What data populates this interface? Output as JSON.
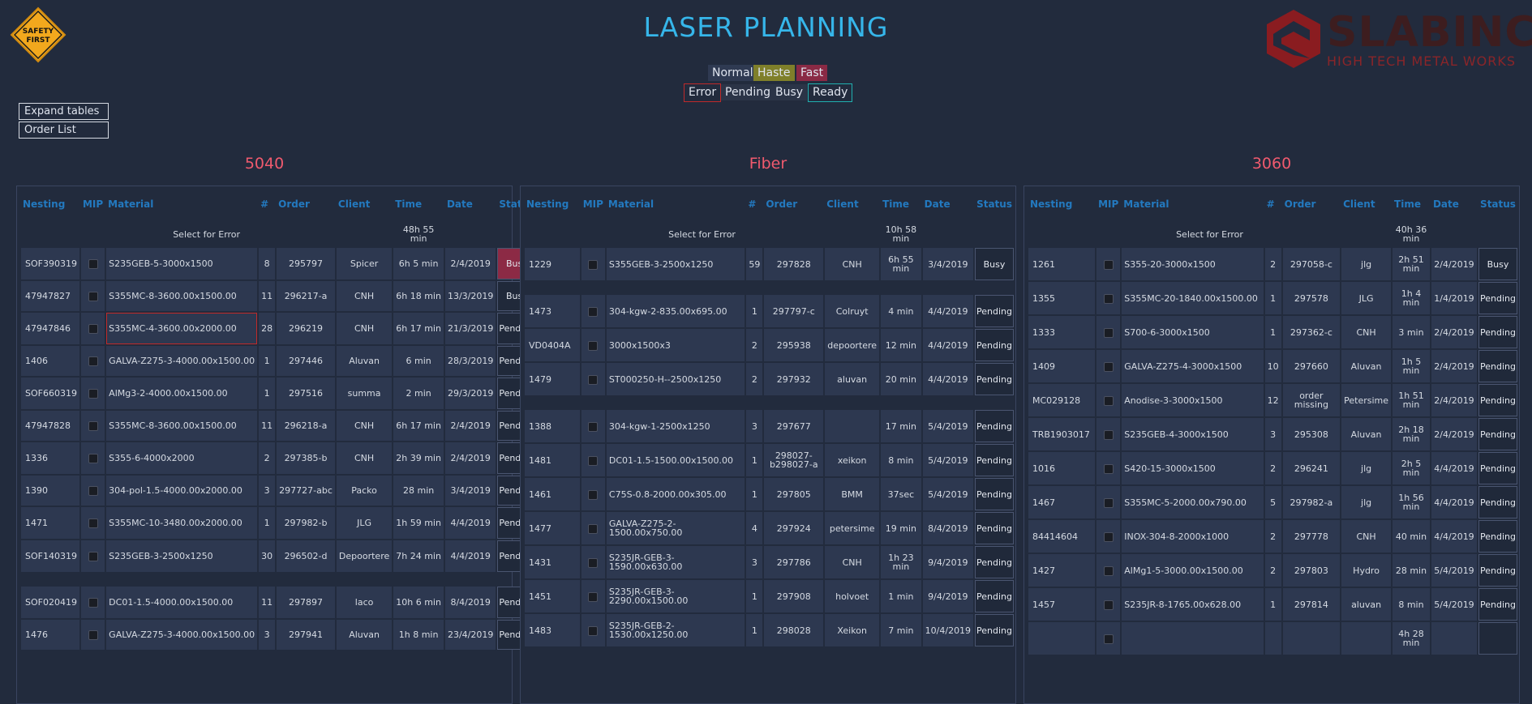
{
  "header": {
    "title": "LASER PLANNING",
    "safety_line1": "SAFETY",
    "safety_line2": "FIRST",
    "logo_name": "SLABINCK",
    "logo_tagline": "HIGH TECH METAL WORKS"
  },
  "legend": {
    "normal": "Normal",
    "haste": "Haste",
    "fast": "Fast",
    "error": "Error",
    "pending": "Pending",
    "busy": "Busy",
    "ready": "Ready"
  },
  "buttons": {
    "expand": "Expand tables",
    "order_list": "Order List"
  },
  "colors": {
    "accent": "#36b6ea",
    "machine_title": "#f05a6e",
    "header_text": "#2379bf",
    "busy_red": "#8c2a45",
    "error_border": "#c12a2a",
    "haste": "#7f7f2a",
    "fast": "#8a2a45"
  },
  "columns": [
    "Nesting",
    "MIP",
    "Material",
    "#",
    "Order",
    "Client",
    "Time",
    "Date",
    "Status"
  ],
  "machines": [
    {
      "name": "5040",
      "select_label": "Select for Error",
      "total_time": "48h 55 min",
      "rows": [
        {
          "nesting": "SOF390319",
          "material": "S235GEB-5-3000x1500",
          "qty": "8",
          "order": "295797",
          "client": "Spicer",
          "time": "6h 5 min",
          "date": "2/4/2019",
          "status": "Busy"
        },
        {
          "nesting": "47947827",
          "material": "S355MC-8-3600.00x1500.00",
          "qty": "11",
          "order": "296217-a",
          "client": "CNH",
          "time": "6h 18 min",
          "date": "13/3/2019",
          "status": "Busy"
        },
        {
          "nesting": "47947846",
          "material": "S355MC-4-3600.00x2000.00",
          "qty": "28",
          "order": "296219",
          "client": "CNH",
          "time": "6h 17 min",
          "date": "21/3/2019",
          "status": "Pending"
        },
        {
          "nesting": "1406",
          "material": "GALVA-Z275-3-4000.00x1500.00",
          "qty": "1",
          "order": "297446",
          "client": "Aluvan",
          "time": "6 min",
          "date": "28/3/2019",
          "status": "Pending"
        },
        {
          "nesting": "SOF660319",
          "material": "AlMg3-2-4000.00x1500.00",
          "qty": "1",
          "order": "297516",
          "client": "summa",
          "time": "2 min",
          "date": "29/3/2019",
          "status": "Pending"
        },
        {
          "nesting": "47947828",
          "material": "S355MC-8-3600.00x1500.00",
          "qty": "11",
          "order": "296218-a",
          "client": "CNH",
          "time": "6h 17 min",
          "date": "2/4/2019",
          "status": "Pending"
        },
        {
          "nesting": "1336",
          "material": "S355-6-4000x2000",
          "qty": "2",
          "order": "297385-b",
          "client": "CNH",
          "time": "2h 39 min",
          "date": "2/4/2019",
          "status": "Pending"
        },
        {
          "nesting": "1390",
          "material": "304-pol-1.5-4000.00x2000.00",
          "qty": "3",
          "order": "297727-abc",
          "client": "Packo",
          "time": "28 min",
          "date": "3/4/2019",
          "status": "Pending"
        },
        {
          "nesting": "1471",
          "material": "S355MC-10-3480.00x2000.00",
          "qty": "1",
          "order": "297982-b",
          "client": "JLG",
          "time": "1h 59 min",
          "date": "4/4/2019",
          "status": "Pending"
        },
        {
          "nesting": "SOF140319",
          "material": "S235GEB-3-2500x1250",
          "qty": "30",
          "order": "296502-d",
          "client": "Depoortere",
          "time": "7h 24 min",
          "date": "4/4/2019",
          "status": "Pending"
        },
        {
          "nesting": "SOF020419",
          "material": "DC01-1.5-4000.00x1500.00",
          "qty": "11",
          "order": "297897",
          "client": "laco",
          "time": "10h 6 min",
          "date": "8/4/2019",
          "status": "Pending"
        },
        {
          "nesting": "1476",
          "material": "GALVA-Z275-3-4000.00x1500.00",
          "qty": "3",
          "order": "297941",
          "client": "Aluvan",
          "time": "1h 8 min",
          "date": "23/4/2019",
          "status": "Pending"
        }
      ]
    },
    {
      "name": "Fiber",
      "select_label": "Select for Error",
      "total_time": "10h 58 min",
      "rows": [
        {
          "nesting": "1229",
          "material": "S355GEB-3-2500x1250",
          "qty": "59",
          "order": "297828",
          "client": "CNH",
          "time": "6h 55 min",
          "date": "3/4/2019",
          "status": "Busy"
        },
        {
          "nesting": "1473",
          "material": "304-kgw-2-835.00x695.00",
          "qty": "1",
          "order": "297797-c",
          "client": "Colruyt",
          "time": "4 min",
          "date": "4/4/2019",
          "status": "Pending"
        },
        {
          "nesting": "VD0404A",
          "material": "3000x1500x3",
          "qty": "2",
          "order": "295938",
          "client": "depoortere",
          "time": "12 min",
          "date": "4/4/2019",
          "status": "Pending"
        },
        {
          "nesting": "1479",
          "material": "ST000250-H--2500x1250",
          "qty": "2",
          "order": "297932",
          "client": "aluvan",
          "time": "20 min",
          "date": "4/4/2019",
          "status": "Pending"
        },
        {
          "nesting": "1388",
          "material": "304-kgw-1-2500x1250",
          "qty": "3",
          "order": "297677",
          "client": "",
          "time": "17 min",
          "date": "5/4/2019",
          "status": "Pending"
        },
        {
          "nesting": "1481",
          "material": "DC01-1.5-1500.00x1500.00",
          "qty": "1",
          "order": "298027-b298027-a",
          "client": "xeikon",
          "time": "8 min",
          "date": "5/4/2019",
          "status": "Pending"
        },
        {
          "nesting": "1461",
          "material": "C75S-0.8-2000.00x305.00",
          "qty": "1",
          "order": "297805",
          "client": "BMM",
          "time": "37sec",
          "date": "5/4/2019",
          "status": "Pending"
        },
        {
          "nesting": "1477",
          "material": "GALVA-Z275-2-1500.00x750.00",
          "qty": "4",
          "order": "297924",
          "client": "petersime",
          "time": "19 min",
          "date": "8/4/2019",
          "status": "Pending"
        },
        {
          "nesting": "1431",
          "material": "S235JR-GEB-3-1590.00x630.00",
          "qty": "3",
          "order": "297786",
          "client": "CNH",
          "time": "1h 23 min",
          "date": "9/4/2019",
          "status": "Pending"
        },
        {
          "nesting": "1451",
          "material": "S235JR-GEB-3-2290.00x1500.00",
          "qty": "1",
          "order": "297908",
          "client": "holvoet",
          "time": "1 min",
          "date": "9/4/2019",
          "status": "Pending"
        },
        {
          "nesting": "1483",
          "material": "S235JR-GEB-2-1530.00x1250.00",
          "qty": "1",
          "order": "298028",
          "client": "Xeikon",
          "time": "7 min",
          "date": "10/4/2019",
          "status": "Pending"
        }
      ]
    },
    {
      "name": "3060",
      "select_label": "Select for Error",
      "total_time": "40h 36 min",
      "rows": [
        {
          "nesting": "1261",
          "material": "S355-20-3000x1500",
          "qty": "2",
          "order": "297058-c",
          "client": "jlg",
          "time": "2h 51 min",
          "date": "2/4/2019",
          "status": "Busy"
        },
        {
          "nesting": "1355",
          "material": "S355MC-20-1840.00x1500.00",
          "qty": "1",
          "order": "297578",
          "client": "JLG",
          "time": "1h 4 min",
          "date": "1/4/2019",
          "status": "Pending"
        },
        {
          "nesting": "1333",
          "material": "S700-6-3000x1500",
          "qty": "1",
          "order": "297362-c",
          "client": "CNH",
          "time": "3 min",
          "date": "2/4/2019",
          "status": "Pending"
        },
        {
          "nesting": "1409",
          "material": "GALVA-Z275-4-3000x1500",
          "qty": "10",
          "order": "297660",
          "client": "Aluvan",
          "time": "1h 5 min",
          "date": "2/4/2019",
          "status": "Pending"
        },
        {
          "nesting": "MC029128",
          "material": "Anodise-3-3000x1500",
          "qty": "12",
          "order": "order missing",
          "client": "Petersime",
          "time": "1h 51 min",
          "date": "2/4/2019",
          "status": "Pending"
        },
        {
          "nesting": "TRB1903017",
          "material": "S235GEB-4-3000x1500",
          "qty": "3",
          "order": "295308",
          "client": "Aluvan",
          "time": "2h 18 min",
          "date": "2/4/2019",
          "status": "Pending"
        },
        {
          "nesting": "1016",
          "material": "S420-15-3000x1500",
          "qty": "2",
          "order": "296241",
          "client": "jlg",
          "time": "2h 5 min",
          "date": "4/4/2019",
          "status": "Pending"
        },
        {
          "nesting": "1467",
          "material": "S355MC-5-2000.00x790.00",
          "qty": "5",
          "order": "297982-a",
          "client": "jlg",
          "time": "1h 56 min",
          "date": "4/4/2019",
          "status": "Pending"
        },
        {
          "nesting": "84414604",
          "material": "INOX-304-8-2000x1000",
          "qty": "2",
          "order": "297778",
          "client": "CNH",
          "time": "40 min",
          "date": "4/4/2019",
          "status": "Pending"
        },
        {
          "nesting": "1427",
          "material": "AlMg1-5-3000.00x1500.00",
          "qty": "2",
          "order": "297803",
          "client": "Hydro",
          "time": "28 min",
          "date": "5/4/2019",
          "status": "Pending"
        },
        {
          "nesting": "1457",
          "material": "S235JR-8-1765.00x628.00",
          "qty": "1",
          "order": "297814",
          "client": "aluvan",
          "time": "8 min",
          "date": "5/4/2019",
          "status": "Pending"
        },
        {
          "nesting": "",
          "material": "",
          "qty": "",
          "order": "",
          "client": "",
          "time": "4h 28 min",
          "date": "",
          "status": ""
        }
      ]
    }
  ]
}
